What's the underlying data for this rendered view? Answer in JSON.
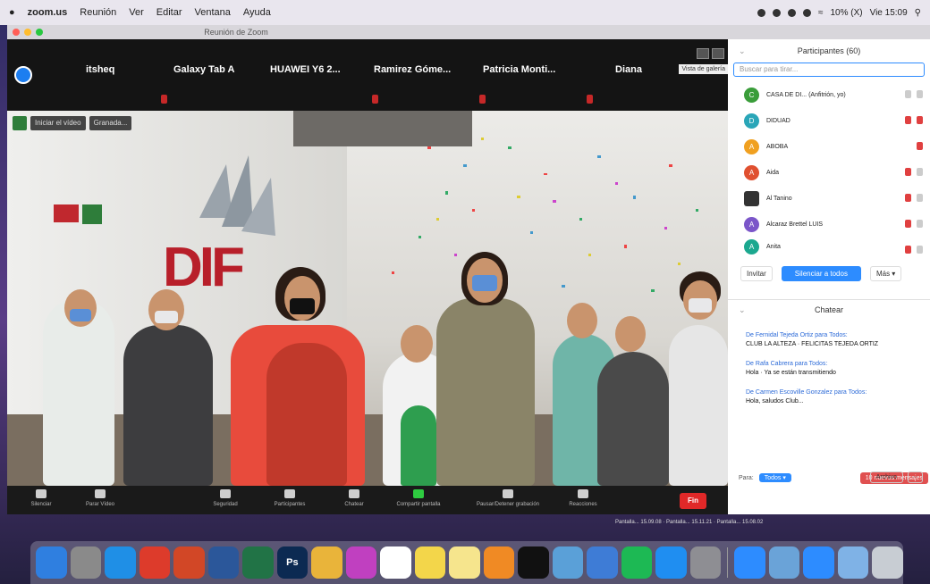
{
  "menubar": {
    "app": "zoom.us",
    "items": [
      "Reunión",
      "Ver",
      "Editar",
      "Ventana",
      "Ayuda"
    ],
    "status": [
      "10% (X)",
      "Vie 15:09"
    ]
  },
  "window": {
    "title": "Reunión de Zoom"
  },
  "participants_strip": [
    {
      "name": "itsheq"
    },
    {
      "name": "Galaxy Tab A"
    },
    {
      "name": "HUAWEI Y6 2..."
    },
    {
      "name": "Ramirez Góme..."
    },
    {
      "name": "Patricia Monti..."
    },
    {
      "name": "Diana"
    }
  ],
  "view": {
    "tooltip": "Vista de galería"
  },
  "video_overlay": {
    "stop_video": "Iniciar el vídeo",
    "name": "Granada..."
  },
  "wall_text": "DIF",
  "toolbar": {
    "items": [
      {
        "label": "Silenciar"
      },
      {
        "label": "Parar Vídeo"
      },
      {
        "label": "Seguridad"
      },
      {
        "label": "Participantes"
      },
      {
        "label": "Chatear"
      },
      {
        "label": "Compartir pantalla"
      },
      {
        "label": "Pausar/Detener grabación"
      },
      {
        "label": "Reacciones"
      }
    ],
    "end": "Fin"
  },
  "panel": {
    "title": "Participantes (60)",
    "search_placeholder": "Buscar para tirar...",
    "participants": [
      {
        "initial": "C",
        "name": "CASA DE DI... (Anfitrión, yo)",
        "color": "#3a9d3a"
      },
      {
        "initial": "D",
        "name": "DIDUAD",
        "color": "#2aa6b8"
      },
      {
        "initial": "A",
        "name": "ABOBA",
        "color": "#f0a020"
      },
      {
        "initial": "A",
        "name": "Aida",
        "color": "#e05030"
      },
      {
        "initial": "",
        "name": "Al Tanino",
        "color": "#333333"
      },
      {
        "initial": "A",
        "name": "Alcaraz Brettel LUIS",
        "color": "#7b56c9"
      },
      {
        "initial": "A",
        "name": "Anita",
        "color": "#1ba88f"
      }
    ],
    "btn_invite": "Invitar",
    "btn_mute_all": "Silenciar a todos",
    "btn_more": "Más ▾",
    "chat_title": "Chatear",
    "messages": [
      {
        "from": "De Fernidal Tejeda Ortiz para Todos:",
        "text": "CLUB LA ALTEZA · FELICITAS TEJEDA ORTIZ"
      },
      {
        "from": "De Rafa Cabrera para Todos:",
        "text": "Hola · Ya se están transmitiendo"
      },
      {
        "from": "De Carmen Escoville Gonzalez para Todos:",
        "text": "Hola, saludos Club..."
      }
    ],
    "unread": "10 nuevos mensajes",
    "to_label": "Para:",
    "to_value": "Todos ▾",
    "file_btn": "Archivo",
    "more_btn": "···"
  },
  "status_line": "Pantalla... 15.09.08 · Pantalla... 15.11.21 · Pantalla... 15.08.02",
  "dock": {
    "apps": [
      {
        "name": "Finder",
        "color": "#2f7fe0",
        "glyph": ""
      },
      {
        "name": "Launchpad",
        "color": "#8a8a8a",
        "glyph": ""
      },
      {
        "name": "Safari",
        "color": "#1f8fe6",
        "glyph": ""
      },
      {
        "name": "Chrome",
        "color": "#dd3b2b",
        "glyph": ""
      },
      {
        "name": "PowerPoint",
        "color": "#d24726",
        "glyph": ""
      },
      {
        "name": "Word",
        "color": "#2b579a",
        "glyph": ""
      },
      {
        "name": "Excel",
        "color": "#217346",
        "glyph": ""
      },
      {
        "name": "Photoshop",
        "color": "#0c2a52",
        "glyph": "Ps"
      },
      {
        "name": "Photos",
        "color": "#e9b43a",
        "glyph": ""
      },
      {
        "name": "Pinwheel",
        "color": "#c040c0",
        "glyph": ""
      },
      {
        "name": "Calendar",
        "color": "#ffffff",
        "glyph": ""
      },
      {
        "name": "Notes",
        "color": "#f3d64a",
        "glyph": ""
      },
      {
        "name": "Stickies",
        "color": "#f6e58d",
        "glyph": ""
      },
      {
        "name": "Photo Booth",
        "color": "#f08a24",
        "glyph": ""
      },
      {
        "name": "Apple TV",
        "color": "#111111",
        "glyph": ""
      },
      {
        "name": "Preview",
        "color": "#5aa0d8",
        "glyph": ""
      },
      {
        "name": "Keynote",
        "color": "#3e7cd6",
        "glyph": ""
      },
      {
        "name": "Spotify",
        "color": "#1db954",
        "glyph": ""
      },
      {
        "name": "App Store",
        "color": "#1f8ef1",
        "glyph": ""
      },
      {
        "name": "Settings",
        "color": "#8e8e93",
        "glyph": ""
      },
      {
        "name": "Zoom",
        "color": "#2d8cff",
        "glyph": ""
      },
      {
        "name": "Documents",
        "color": "#6aa3d8",
        "glyph": ""
      },
      {
        "name": "Zoom Meeting",
        "color": "#2d8cff",
        "glyph": ""
      },
      {
        "name": "Downloads",
        "color": "#7fb2e6",
        "glyph": ""
      },
      {
        "name": "Trash",
        "color": "#c8cdd3",
        "glyph": ""
      }
    ]
  }
}
